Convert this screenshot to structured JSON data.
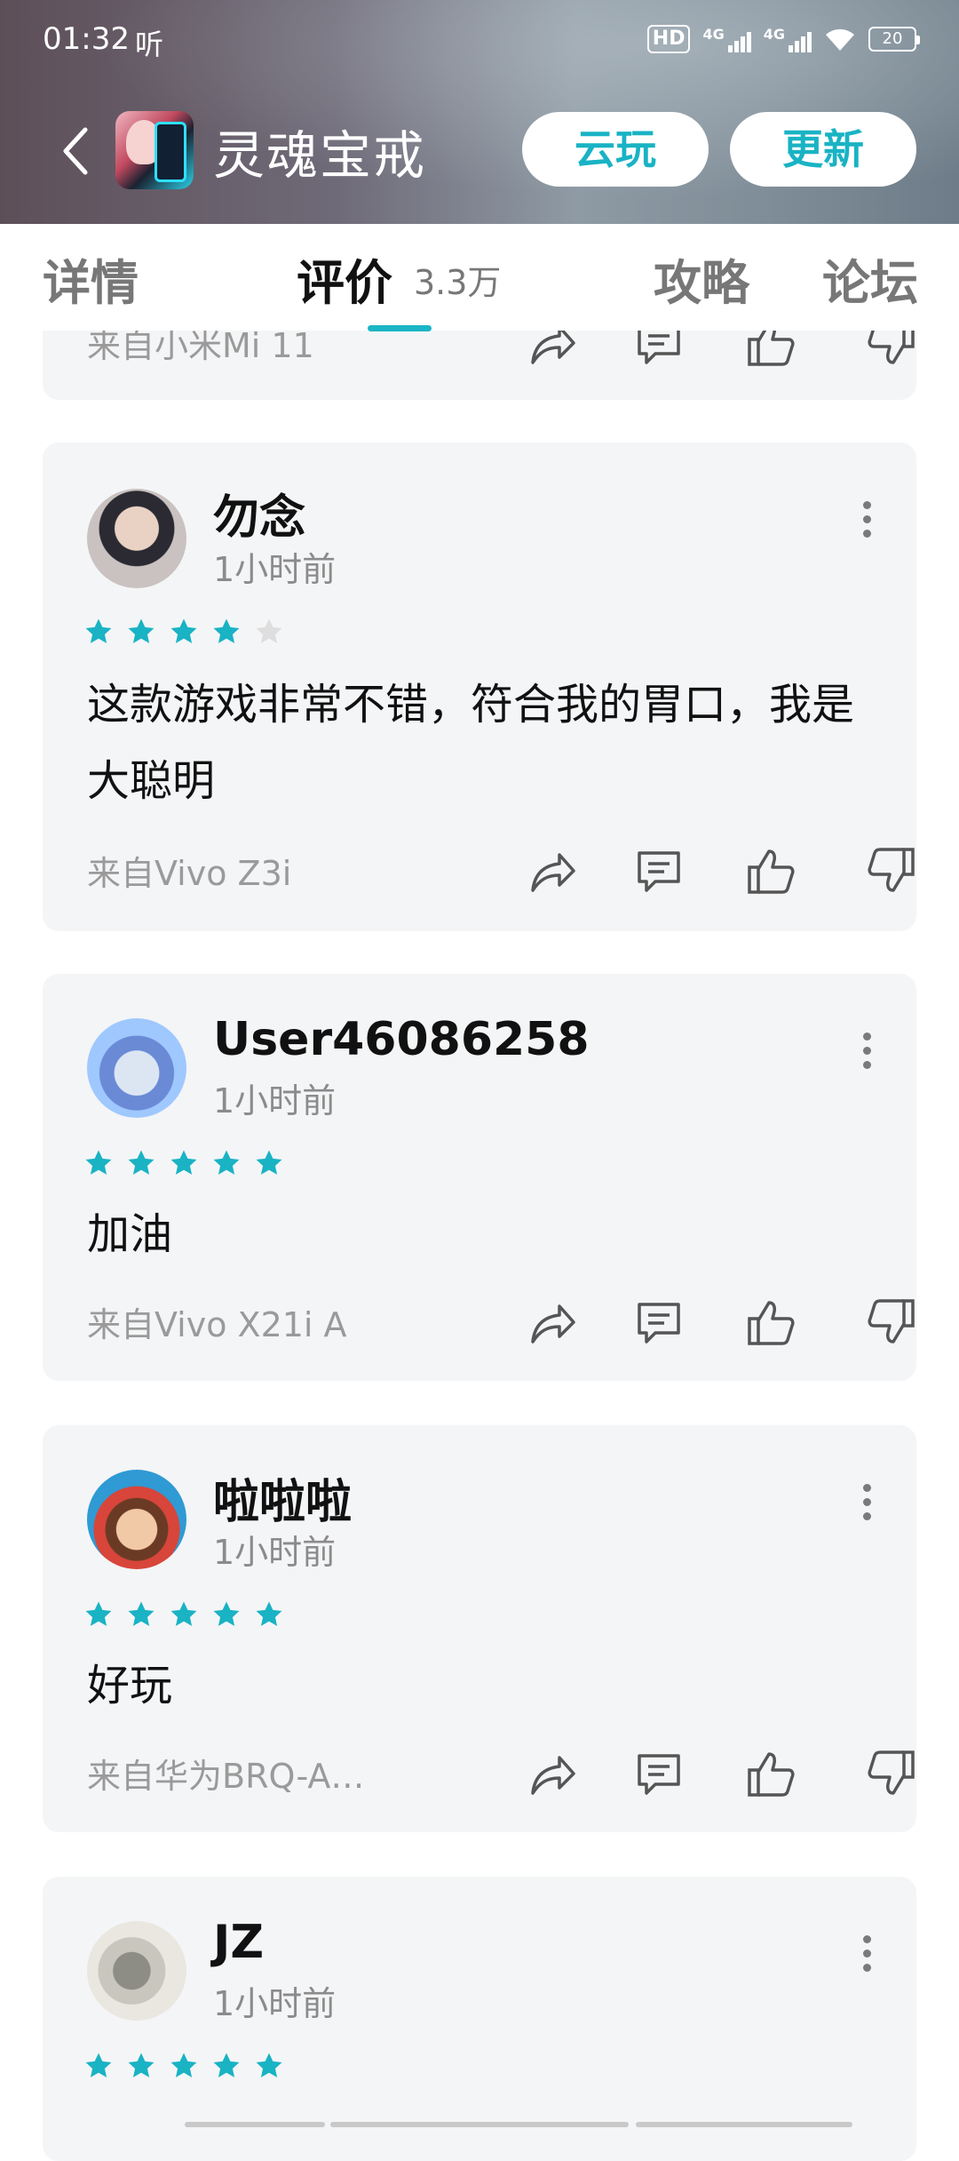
{
  "status_bar": {
    "time": "01:32",
    "listen_icon_text": "听",
    "hd_label": "HD",
    "net1": "4G",
    "net2": "4G",
    "battery": "20"
  },
  "app_bar": {
    "title": "灵魂宝戒",
    "cloud_play_label": "云玩",
    "update_label": "更新",
    "accent_color": "#19b3c4"
  },
  "tabs": [
    {
      "label": "详情"
    },
    {
      "label": "评价",
      "count": "3.3万",
      "active": true
    },
    {
      "label": "攻略"
    },
    {
      "label": "论坛"
    }
  ],
  "reviews": [
    {
      "user": "",
      "time": "",
      "rating": 0,
      "content": "",
      "device": "来自小米Mi 11",
      "partial": true
    },
    {
      "user": "勿念",
      "time": "1小时前",
      "rating": 4,
      "content": "这款游戏非常不错，符合我的胃口，我是大聪明",
      "device": "来自Vivo Z3i"
    },
    {
      "user": "User46086258",
      "time": "1小时前",
      "rating": 5,
      "content": "加油",
      "device": "来自Vivo X21i A"
    },
    {
      "user": "啦啦啦",
      "time": "1小时前",
      "rating": 5,
      "content": "好玩",
      "device": "来自华为BRQ-A…"
    },
    {
      "user": "JZ",
      "time": "1小时前",
      "rating": 5,
      "content": "",
      "device": ""
    }
  ],
  "icons": {
    "share": "share-icon",
    "comment": "comment-icon",
    "like": "thumbs-up-icon",
    "dislike": "thumbs-down-icon",
    "more": "more-vertical-icon"
  }
}
